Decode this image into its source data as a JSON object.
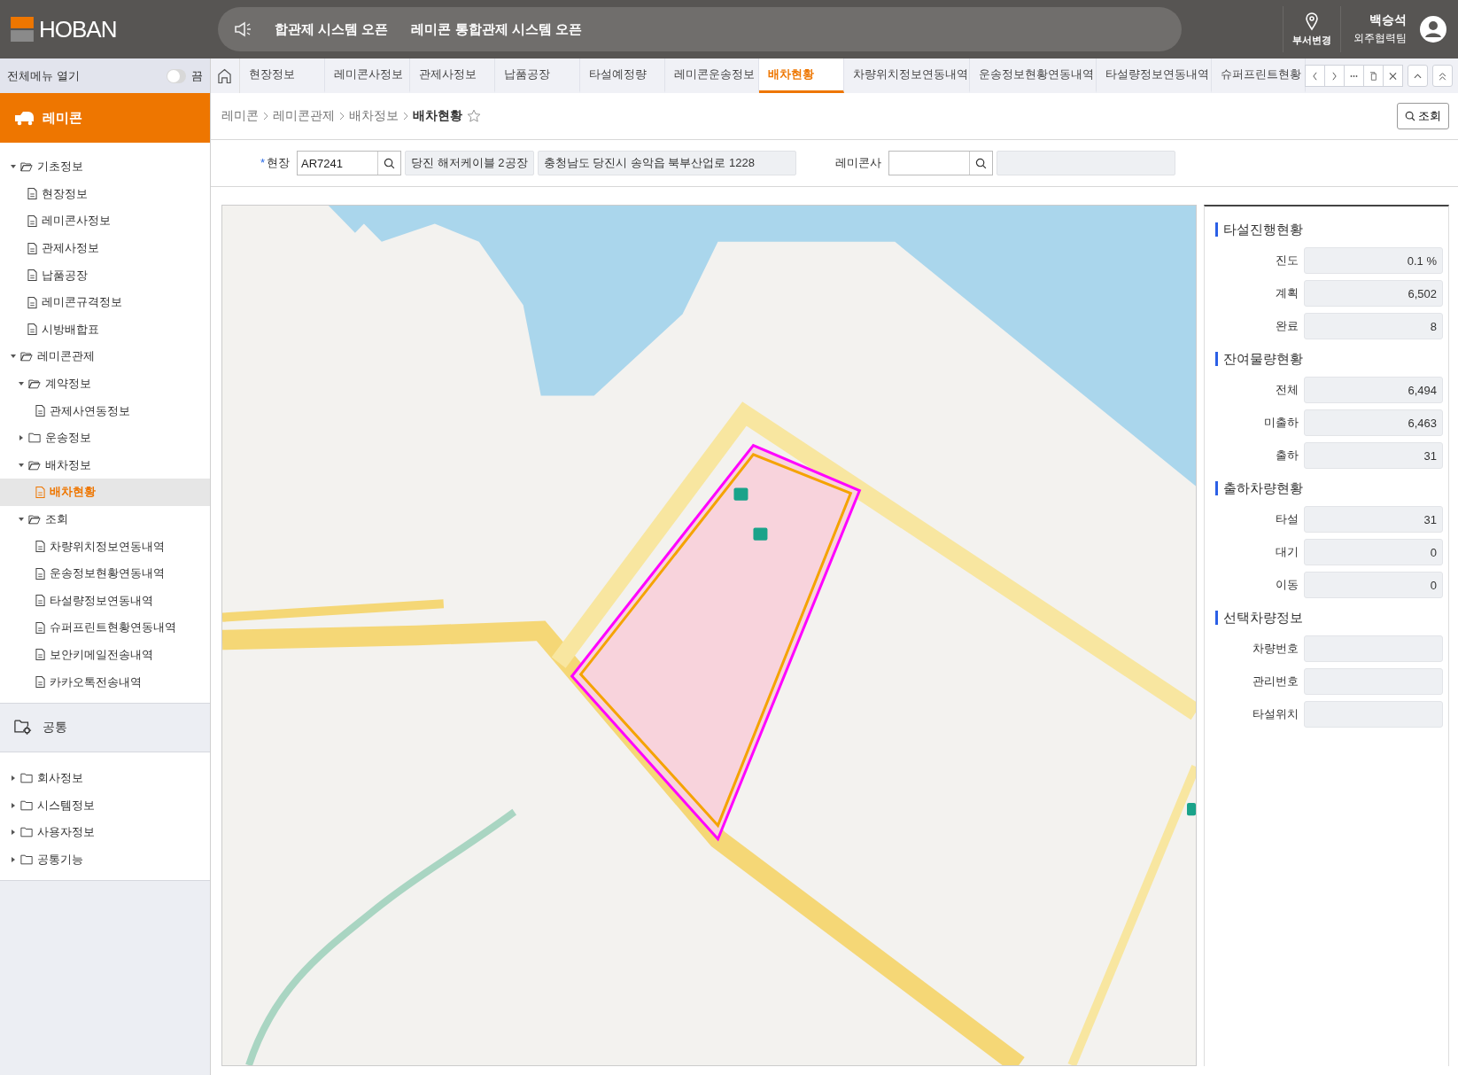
{
  "header": {
    "logo": "HOBAN",
    "notices": [
      "합관제 시스템 오픈",
      "레미콘 통합관제 시스템 오픈"
    ],
    "dept_change_label": "부서변경",
    "user": {
      "name": "백승석",
      "team": "외주협력팀"
    }
  },
  "sidebar": {
    "toggle": {
      "label": "전체메뉴 열기",
      "state_label": "끔",
      "on": false
    },
    "section_title": "레미콘",
    "tree": [
      {
        "label": "기초정보",
        "kind": "folder",
        "expanded": true,
        "children": [
          {
            "label": "현장정보",
            "kind": "page",
            "selected": false
          },
          {
            "label": "레미콘사정보",
            "kind": "page",
            "selected": false
          },
          {
            "label": "관제사정보",
            "kind": "page",
            "selected": false
          },
          {
            "label": "납품공장",
            "kind": "page",
            "selected": false
          },
          {
            "label": "레미콘규격정보",
            "kind": "page",
            "selected": false
          },
          {
            "label": "시방배합표",
            "kind": "page",
            "selected": false
          }
        ]
      },
      {
        "label": "레미콘관제",
        "kind": "folder",
        "expanded": true,
        "children": [
          {
            "label": "계약정보",
            "kind": "folder",
            "expanded": true,
            "children": [
              {
                "label": "관제사연동정보",
                "kind": "page",
                "selected": false
              }
            ]
          },
          {
            "label": "운송정보",
            "kind": "folder",
            "expanded": false
          },
          {
            "label": "배차정보",
            "kind": "folder",
            "expanded": true,
            "children": [
              {
                "label": "배차현황",
                "kind": "page",
                "selected": true
              }
            ]
          },
          {
            "label": "조회",
            "kind": "folder",
            "expanded": true,
            "children": [
              {
                "label": "차량위치정보연동내역",
                "kind": "page",
                "selected": false
              },
              {
                "label": "운송정보현황연동내역",
                "kind": "page",
                "selected": false
              },
              {
                "label": "타설량정보연동내역",
                "kind": "page",
                "selected": false
              },
              {
                "label": "슈퍼프린트현황연동내역",
                "kind": "page",
                "selected": false
              },
              {
                "label": "보안키메일전송내역",
                "kind": "page",
                "selected": false
              },
              {
                "label": "카카오톡전송내역",
                "kind": "page",
                "selected": false
              }
            ]
          }
        ]
      }
    ],
    "common_title": "공통",
    "common_tree": [
      {
        "label": "회사정보",
        "kind": "folder",
        "expanded": false
      },
      {
        "label": "시스템정보",
        "kind": "folder",
        "expanded": false
      },
      {
        "label": "사용자정보",
        "kind": "folder",
        "expanded": false
      },
      {
        "label": "공통기능",
        "kind": "folder",
        "expanded": false
      }
    ]
  },
  "tabs": [
    {
      "label": "현장정보",
      "selected": false
    },
    {
      "label": "레미콘사정보",
      "selected": false
    },
    {
      "label": "관제사정보",
      "selected": false
    },
    {
      "label": "납품공장",
      "selected": false
    },
    {
      "label": "타설예정량",
      "selected": false
    },
    {
      "label": "레미콘운송정보",
      "selected": false
    },
    {
      "label": "배차현황",
      "selected": true
    },
    {
      "label": "차량위치정보연동내역",
      "selected": false
    },
    {
      "label": "운송정보현황연동내역",
      "selected": false
    },
    {
      "label": "타설량정보연동내역",
      "selected": false
    },
    {
      "label": "슈퍼프린트현황",
      "selected": false
    }
  ],
  "breadcrumb": [
    "레미콘",
    "레미콘관제",
    "배차정보",
    "배차현황"
  ],
  "search_button": "조회",
  "filters": {
    "site": {
      "label": "현장",
      "required_mark": "*",
      "value": "AR7241",
      "name": "당진 해저케이블 2공장",
      "address": "충청남도 당진시 송악읍 북부산업로 1228"
    },
    "supplier": {
      "label": "레미콘사"
    }
  },
  "status_sections": [
    {
      "title": "타설진행현황",
      "rows": [
        {
          "label": "진도",
          "value": "0.1 %"
        },
        {
          "label": "계획",
          "value": "6,502"
        },
        {
          "label": "완료",
          "value": "8"
        }
      ]
    },
    {
      "title": "잔여물량현황",
      "rows": [
        {
          "label": "전체",
          "value": "6,494"
        },
        {
          "label": "미출하",
          "value": "6,463"
        },
        {
          "label": "출하",
          "value": "31"
        }
      ]
    },
    {
      "title": "출하차량현황",
      "rows": [
        {
          "label": "타설",
          "value": "31"
        },
        {
          "label": "대기",
          "value": "0"
        },
        {
          "label": "이동",
          "value": "0"
        }
      ]
    },
    {
      "title": "선택차량정보",
      "rows": [
        {
          "label": "차량번호"
        },
        {
          "label": "관리번호"
        },
        {
          "label": "타설위치"
        }
      ]
    }
  ]
}
